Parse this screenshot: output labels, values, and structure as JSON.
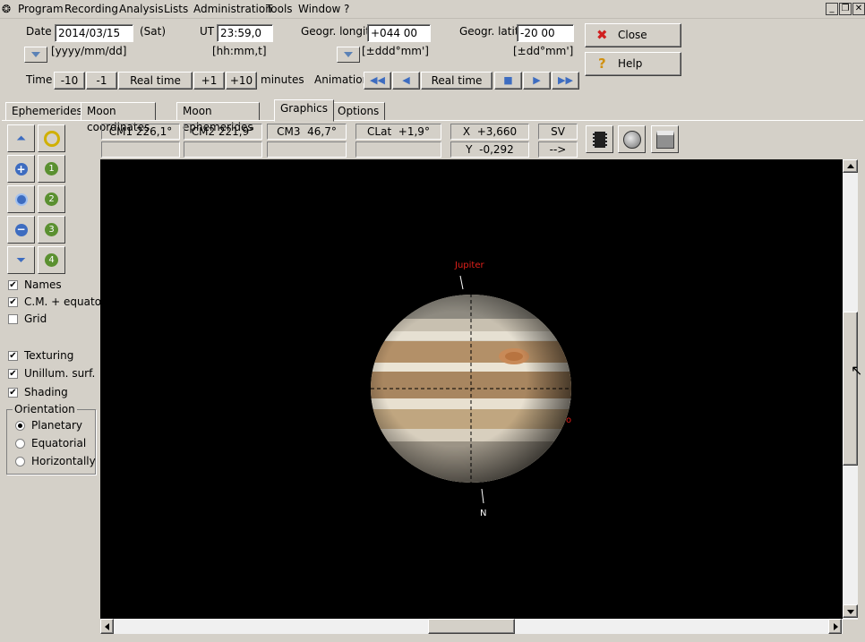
{
  "menu": {
    "items": [
      "Program",
      "Recording",
      "Analysis",
      "Lists",
      "Administration",
      "Tools",
      "Window",
      "?"
    ]
  },
  "top": {
    "date_label": "Date",
    "date_value": "2014/03/15",
    "weekday": "(Sat)",
    "date_format": "[yyyy/mm/dd]",
    "ut_label": "UT",
    "ut_value": "23:59,0",
    "ut_format": "[hh:mm,t]",
    "longit_label": "Geogr. longit.",
    "longit_value": "+044 00",
    "longit_format": "[±ddd°mm']",
    "latit_label": "Geogr. latit.",
    "latit_value": "-20 00",
    "latit_format": "[±dd°mm']",
    "close_label": "Close",
    "help_label": "Help",
    "time_label": "Time",
    "time_buttons": [
      "-10",
      "-1",
      "Real time",
      "+1",
      "+10"
    ],
    "minutes_label": "minutes",
    "animation_label": "Animation",
    "animation_realtime": "Real time"
  },
  "tabs": [
    "Ephemerides",
    "Moon coordinates",
    "Moon ephemerides",
    "Graphics",
    "Options"
  ],
  "active_tab": "Graphics",
  "info": {
    "cm1": "CM1 226,1°",
    "cm2": "CM2 221,9°",
    "cm3": "CM3  46,7°",
    "clat": "CLat  +1,9°",
    "x": "X  +3,660",
    "y": "Y  -0,292",
    "sv": "SV",
    "arrow": "-->"
  },
  "sidebar": {
    "moon_numbers": [
      "1",
      "2",
      "3",
      "4"
    ],
    "checkboxes": [
      {
        "label": "Names",
        "checked": true
      },
      {
        "label": "C.M. + equator",
        "checked": true
      },
      {
        "label": "Grid",
        "checked": false
      },
      {
        "label": "Texturing",
        "checked": true
      },
      {
        "label": "Unillum. surf.",
        "checked": true
      },
      {
        "label": "Shading",
        "checked": true
      }
    ],
    "orientation_title": "Orientation",
    "orientation_options": [
      "Planetary",
      "Equatorial",
      "Horizontally"
    ],
    "orientation_selected": "Planetary"
  },
  "canvas": {
    "planet_label": "Jupiter",
    "north_label": "N",
    "moon_label_partial": "o",
    "label_color": "#e0201a"
  }
}
